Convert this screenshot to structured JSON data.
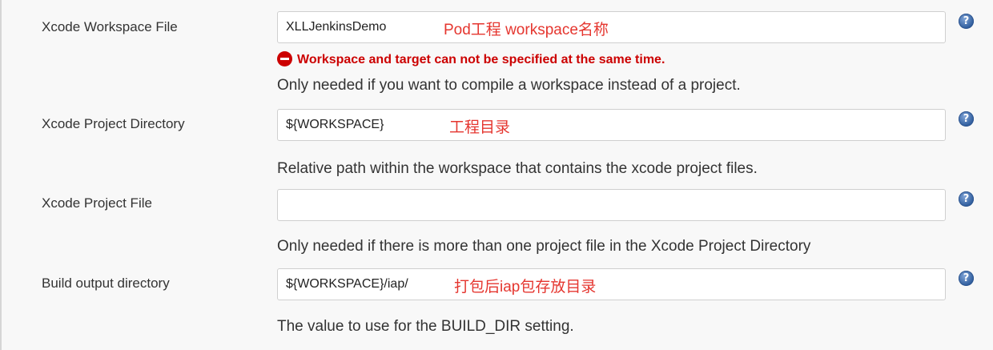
{
  "rows": [
    {
      "label": "Xcode Workspace File",
      "value": "XLLJenkinsDemo",
      "annotation": "Pod工程 workspace名称",
      "error": "Workspace and target can not be specified at the same time.",
      "description": "Only needed if you want to compile a workspace instead of a project."
    },
    {
      "label": "Xcode Project Directory",
      "value": "${WORKSPACE}",
      "annotation": "工程目录",
      "description": "Relative path within the workspace that contains the xcode project files."
    },
    {
      "label": "Xcode Project File",
      "value": "",
      "description": "Only needed if there is more than one project file in the Xcode Project Directory"
    },
    {
      "label": "Build output directory",
      "value": "${WORKSPACE}/iap/",
      "annotation": "打包后iap包存放目录",
      "description": "The value to use for the BUILD_DIR setting."
    }
  ],
  "help_icon": "question-mark-icon",
  "error_icon": "error-minus-icon",
  "colors": {
    "annotation": "#e5362f",
    "error": "#cc0000",
    "help": "#2e5c9c"
  }
}
